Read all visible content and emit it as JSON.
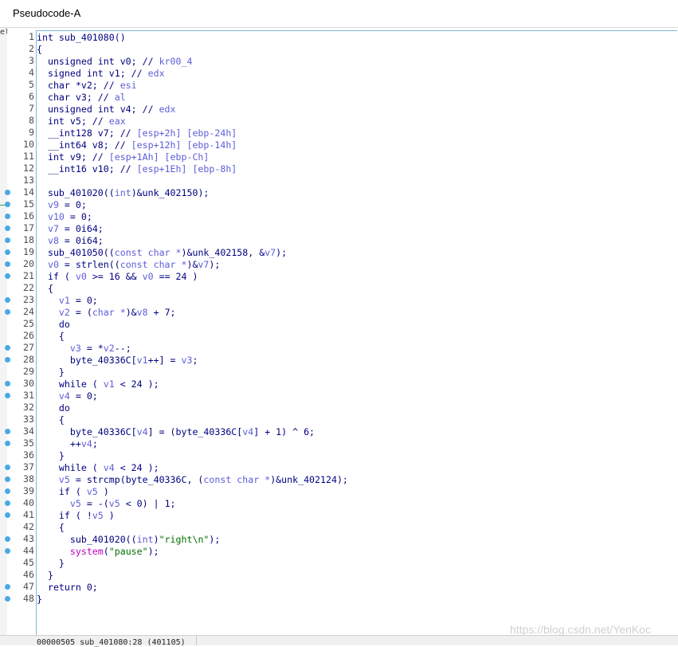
{
  "window": {
    "tab_title": "Pseudocode-A"
  },
  "gutter": {
    "line_numbers": [
      "1",
      "2",
      "3",
      "4",
      "5",
      "6",
      "7",
      "8",
      "9",
      "10",
      "11",
      "12",
      "13",
      "14",
      "15",
      "16",
      "17",
      "18",
      "19",
      "20",
      "21",
      "22",
      "23",
      "24",
      "25",
      "26",
      "27",
      "28",
      "29",
      "30",
      "31",
      "32",
      "33",
      "34",
      "35",
      "36",
      "37",
      "38",
      "39",
      "40",
      "41",
      "42",
      "43",
      "44",
      "45",
      "46",
      "47",
      "48"
    ],
    "breakpoint_lines": [
      14,
      15,
      16,
      17,
      18,
      19,
      20,
      21,
      23,
      24,
      27,
      28,
      30,
      31,
      34,
      35,
      37,
      38,
      39,
      40,
      41,
      43,
      44,
      47,
      48
    ]
  },
  "code_lines": [
    [
      [
        "int sub_401080()",
        "txt"
      ]
    ],
    [
      [
        "{",
        "txt"
      ]
    ],
    [
      [
        "  unsigned int v0; // ",
        "txt"
      ],
      [
        "kr00_4",
        "c"
      ]
    ],
    [
      [
        "  signed int v1; // ",
        "txt"
      ],
      [
        "edx",
        "c"
      ]
    ],
    [
      [
        "  char *v2; // ",
        "txt"
      ],
      [
        "esi",
        "c"
      ]
    ],
    [
      [
        "  char v3; // ",
        "txt"
      ],
      [
        "al",
        "c"
      ]
    ],
    [
      [
        "  unsigned int v4; // ",
        "txt"
      ],
      [
        "edx",
        "c"
      ]
    ],
    [
      [
        "  int v5; // ",
        "txt"
      ],
      [
        "eax",
        "c"
      ]
    ],
    [
      [
        "  __int128 v7; // ",
        "txt"
      ],
      [
        "[esp+2h] [ebp-24h]",
        "c"
      ]
    ],
    [
      [
        "  __int64 v8; // ",
        "txt"
      ],
      [
        "[esp+12h] [ebp-14h]",
        "c"
      ]
    ],
    [
      [
        "  int v9; // ",
        "txt"
      ],
      [
        "[esp+1Ah] [ebp-Ch]",
        "c"
      ]
    ],
    [
      [
        "  __int16 v10; // ",
        "txt"
      ],
      [
        "[esp+1Eh] [ebp-8h]",
        "c"
      ]
    ],
    [
      [
        "",
        "txt"
      ]
    ],
    [
      [
        "  sub_401020((",
        "txt"
      ],
      [
        "int",
        "c"
      ],
      [
        ")&unk_402150);",
        "txt"
      ]
    ],
    [
      [
        "  ",
        "txt"
      ],
      [
        "v9",
        "v"
      ],
      [
        " = 0;",
        "txt"
      ]
    ],
    [
      [
        "  ",
        "txt"
      ],
      [
        "v10",
        "v"
      ],
      [
        " = 0;",
        "txt"
      ]
    ],
    [
      [
        "  ",
        "txt"
      ],
      [
        "v7",
        "v"
      ],
      [
        " = 0i64;",
        "txt"
      ]
    ],
    [
      [
        "  ",
        "txt"
      ],
      [
        "v8",
        "v"
      ],
      [
        " = 0i64;",
        "txt"
      ]
    ],
    [
      [
        "  sub_401050((",
        "txt"
      ],
      [
        "const char *",
        "c"
      ],
      [
        ")&unk_402158, &",
        "txt"
      ],
      [
        "v7",
        "v"
      ],
      [
        ");",
        "txt"
      ]
    ],
    [
      [
        "  ",
        "txt"
      ],
      [
        "v0",
        "v"
      ],
      [
        " = strlen((",
        "txt"
      ],
      [
        "const char *",
        "c"
      ],
      [
        ")&",
        "txt"
      ],
      [
        "v7",
        "v"
      ],
      [
        ");",
        "txt"
      ]
    ],
    [
      [
        "  if ( ",
        "txt"
      ],
      [
        "v0",
        "v"
      ],
      [
        " >= 16 && ",
        "txt"
      ],
      [
        "v0",
        "v"
      ],
      [
        " == 24 )",
        "txt"
      ]
    ],
    [
      [
        "  {",
        "txt"
      ]
    ],
    [
      [
        "    ",
        "txt"
      ],
      [
        "v1",
        "v"
      ],
      [
        " = 0;",
        "txt"
      ]
    ],
    [
      [
        "    ",
        "txt"
      ],
      [
        "v2",
        "v"
      ],
      [
        " = (",
        "txt"
      ],
      [
        "char *",
        "c"
      ],
      [
        ")&",
        "txt"
      ],
      [
        "v8",
        "v"
      ],
      [
        " + 7;",
        "txt"
      ]
    ],
    [
      [
        "    do",
        "txt"
      ]
    ],
    [
      [
        "    {",
        "txt"
      ]
    ],
    [
      [
        "      ",
        "txt"
      ],
      [
        "v3",
        "v"
      ],
      [
        " = *",
        "txt"
      ],
      [
        "v2",
        "v"
      ],
      [
        "--;",
        "txt"
      ]
    ],
    [
      [
        "      byte_40336C[",
        "txt"
      ],
      [
        "v1",
        "v"
      ],
      [
        "++] = ",
        "txt"
      ],
      [
        "v3",
        "v"
      ],
      [
        ";",
        "txt"
      ]
    ],
    [
      [
        "    }",
        "txt"
      ]
    ],
    [
      [
        "    while ( ",
        "txt"
      ],
      [
        "v1",
        "v"
      ],
      [
        " < 24 );",
        "txt"
      ]
    ],
    [
      [
        "    ",
        "txt"
      ],
      [
        "v4",
        "v"
      ],
      [
        " = 0;",
        "txt"
      ]
    ],
    [
      [
        "    do",
        "txt"
      ]
    ],
    [
      [
        "    {",
        "txt"
      ]
    ],
    [
      [
        "      byte_40336C[",
        "txt"
      ],
      [
        "v4",
        "v"
      ],
      [
        "] = (byte_40336C[",
        "txt"
      ],
      [
        "v4",
        "v"
      ],
      [
        "] + 1) ^ 6;",
        "txt"
      ]
    ],
    [
      [
        "      ++",
        "txt"
      ],
      [
        "v4",
        "v"
      ],
      [
        ";",
        "txt"
      ]
    ],
    [
      [
        "    }",
        "txt"
      ]
    ],
    [
      [
        "    while ( ",
        "txt"
      ],
      [
        "v4",
        "v"
      ],
      [
        " < 24 );",
        "txt"
      ]
    ],
    [
      [
        "    ",
        "txt"
      ],
      [
        "v5",
        "v"
      ],
      [
        " = strcmp(byte_40336C, (",
        "txt"
      ],
      [
        "const char *",
        "c"
      ],
      [
        ")&unk_402124);",
        "txt"
      ]
    ],
    [
      [
        "    if ( ",
        "txt"
      ],
      [
        "v5",
        "v"
      ],
      [
        " )",
        "txt"
      ]
    ],
    [
      [
        "      ",
        "txt"
      ],
      [
        "v5",
        "v"
      ],
      [
        " = -(",
        "txt"
      ],
      [
        "v5",
        "v"
      ],
      [
        " < 0) | 1;",
        "txt"
      ]
    ],
    [
      [
        "    if ( !",
        "txt"
      ],
      [
        "v5",
        "v"
      ],
      [
        " )",
        "txt"
      ]
    ],
    [
      [
        "    {",
        "txt"
      ]
    ],
    [
      [
        "      sub_401020((",
        "txt"
      ],
      [
        "int",
        "c"
      ],
      [
        ")",
        "txt"
      ],
      [
        "\"right\\n\"",
        "s"
      ],
      [
        ");",
        "txt"
      ]
    ],
    [
      [
        "      ",
        "txt"
      ],
      [
        "system",
        "pink"
      ],
      [
        "(",
        "txt"
      ],
      [
        "\"pause\"",
        "s"
      ],
      [
        ");",
        "txt"
      ]
    ],
    [
      [
        "    }",
        "txt"
      ]
    ],
    [
      [
        "  }",
        "txt"
      ]
    ],
    [
      [
        "  return 0;",
        "txt"
      ]
    ],
    [
      [
        "}",
        "txt"
      ]
    ]
  ],
  "status": {
    "text": "00000505 sub_401080:28 (401105)"
  },
  "watermark": "https://blog.csdn.net/YenKoc",
  "colors": {
    "text": "#000080",
    "var": "#5d5dd9",
    "string": "#007000",
    "accent_border": "#7fb6dc",
    "breakpoint_dot": "#4aa8e6"
  }
}
